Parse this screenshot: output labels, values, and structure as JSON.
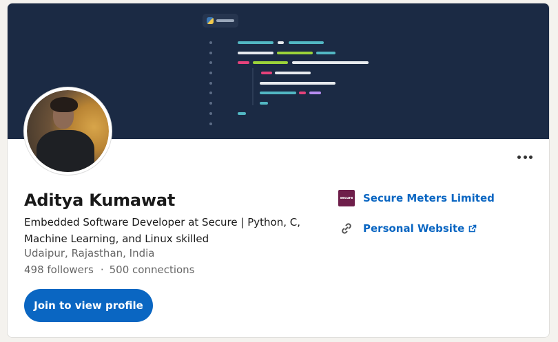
{
  "profile": {
    "name": "Aditya Kumawat",
    "headline": "Embedded Software Developer at Secure | Python, C, Machine Learning, and Linux skilled",
    "location": "Udaipur, Rajasthan, India",
    "followers": "498 followers",
    "separator": "·",
    "connections": "500 connections"
  },
  "actions": {
    "join_label": "Join to view profile"
  },
  "right_panel": {
    "company": {
      "name": "Secure Meters Limited",
      "logo_text": "secure"
    },
    "website": {
      "label": "Personal Website"
    }
  },
  "colors": {
    "brand_blue": "#0a66c2",
    "banner_bg": "#1b2a44",
    "company_logo": "#6e1e4a"
  },
  "icons": {
    "more": "more-horizontal-icon",
    "link": "link-icon",
    "external": "external-link-icon",
    "python": "python-icon"
  }
}
